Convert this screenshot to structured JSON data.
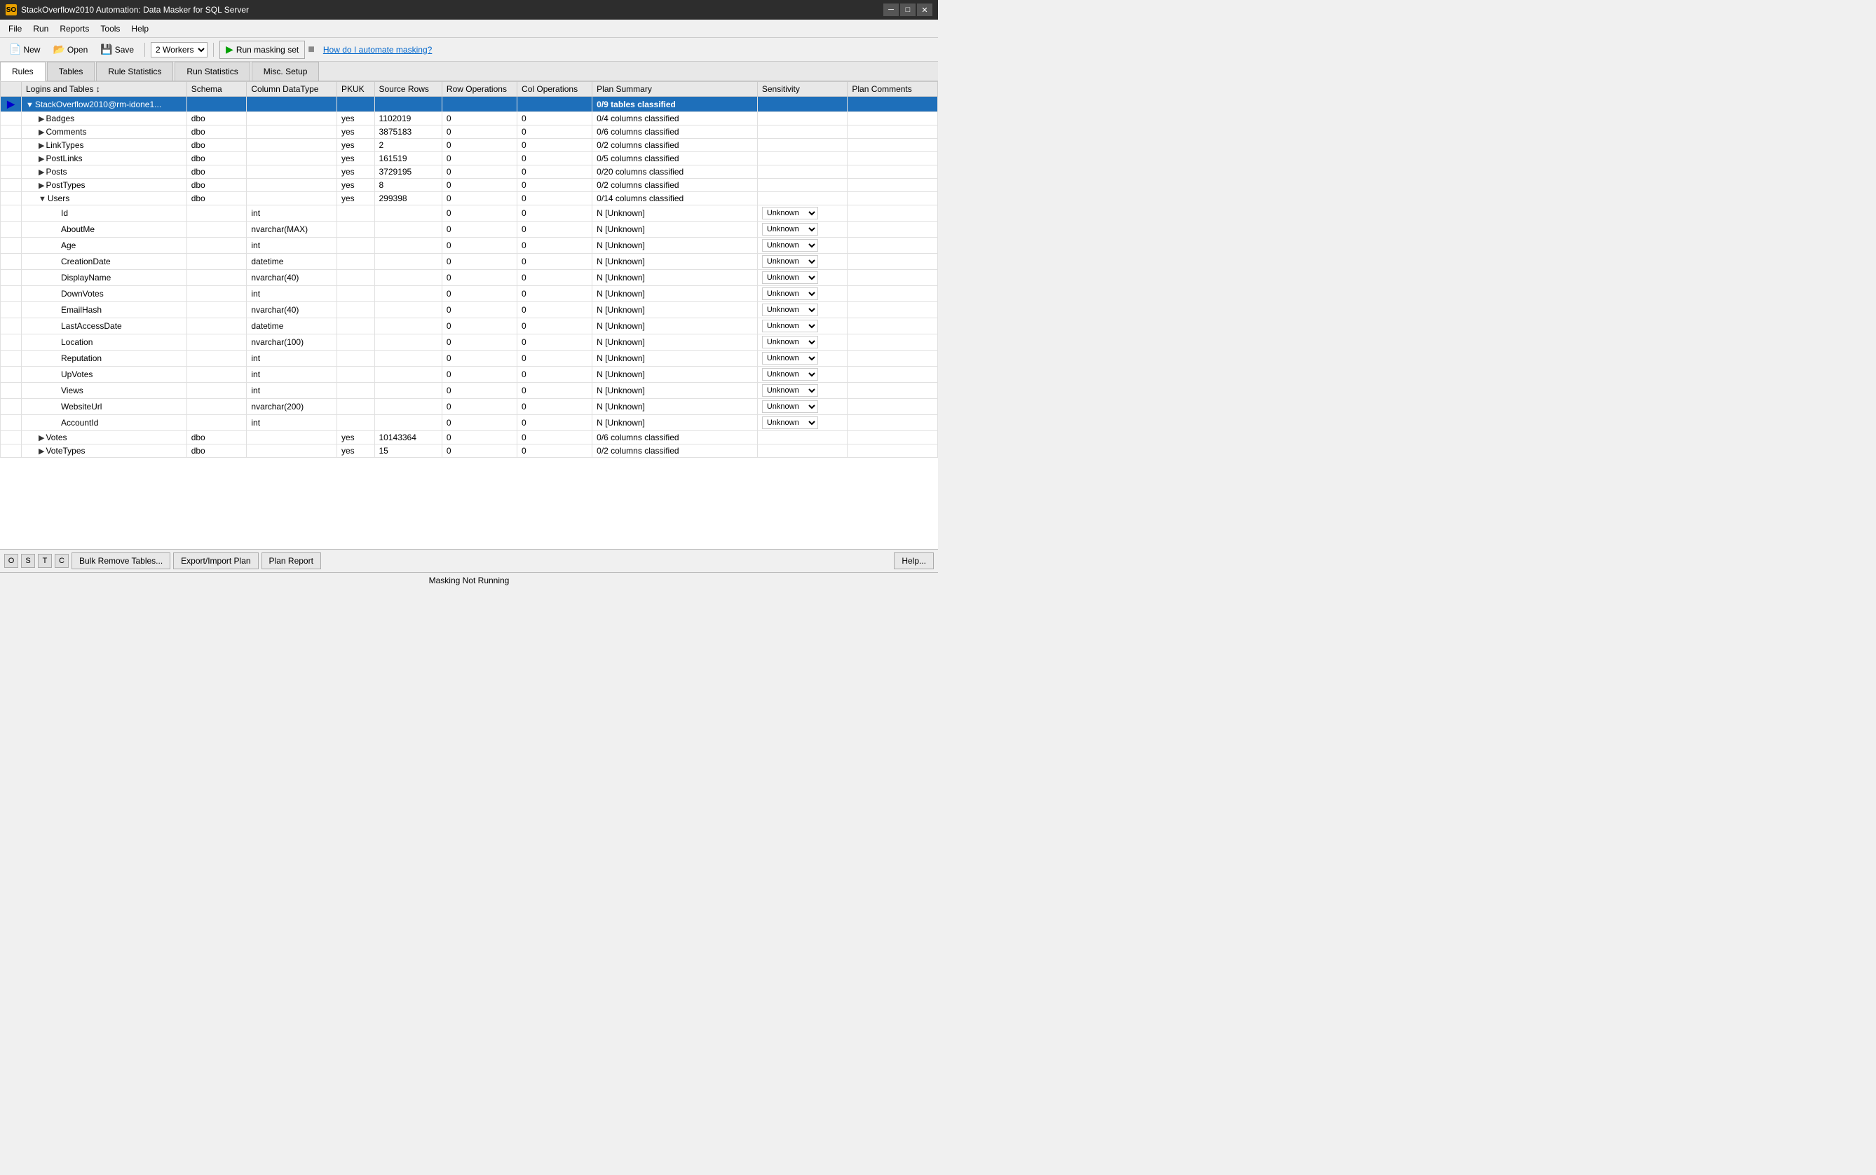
{
  "titleBar": {
    "icon": "SO",
    "title": "StackOverflow2010 Automation: Data Masker for SQL Server",
    "minimizeBtn": "─",
    "maximizeBtn": "□",
    "closeBtn": "✕"
  },
  "menuBar": {
    "items": [
      "File",
      "Run",
      "Reports",
      "Tools",
      "Help"
    ]
  },
  "toolbar": {
    "newLabel": "New",
    "openLabel": "Open",
    "saveLabel": "Save",
    "workersLabel": "2 Workers",
    "runLabel": "Run masking set",
    "helpLink": "How do I automate masking?"
  },
  "tabs": [
    {
      "id": "rules",
      "label": "Rules",
      "active": true
    },
    {
      "id": "tables",
      "label": "Tables",
      "active": false
    },
    {
      "id": "rule-statistics",
      "label": "Rule Statistics",
      "active": false
    },
    {
      "id": "run-statistics",
      "label": "Run Statistics",
      "active": false
    },
    {
      "id": "misc-setup",
      "label": "Misc. Setup",
      "active": false
    }
  ],
  "tableHeaders": [
    {
      "key": "logins",
      "label": "Logins and Tables"
    },
    {
      "key": "schema",
      "label": "Schema"
    },
    {
      "key": "datatype",
      "label": "Column DataType"
    },
    {
      "key": "pkuk",
      "label": "PKUK"
    },
    {
      "key": "sourceRows",
      "label": "Source Rows"
    },
    {
      "key": "rowOps",
      "label": "Row Operations"
    },
    {
      "key": "colOps",
      "label": "Col Operations"
    },
    {
      "key": "planSummary",
      "label": "Plan Summary"
    },
    {
      "key": "sensitivity",
      "label": "Sensitivity"
    },
    {
      "key": "planComments",
      "label": "Plan Comments"
    }
  ],
  "tableRows": [
    {
      "id": "db-root",
      "level": 1,
      "expandable": true,
      "expanded": true,
      "selected": true,
      "currentRow": true,
      "name": "StackOverflow2010@rm-idone1...",
      "schema": "",
      "datatype": "",
      "pkuk": "",
      "sourceRows": "",
      "rowOps": "",
      "colOps": "",
      "planSummary": "0/9 tables classified",
      "sensitivity": "",
      "planComments": ""
    },
    {
      "id": "badges",
      "level": 2,
      "expandable": true,
      "expanded": false,
      "selected": false,
      "name": "Badges",
      "schema": "dbo",
      "datatype": "",
      "pkuk": "yes",
      "sourceRows": "1102019",
      "rowOps": "0",
      "colOps": "0",
      "planSummary": "0/4 columns classified",
      "sensitivity": "",
      "planComments": ""
    },
    {
      "id": "comments",
      "level": 2,
      "expandable": true,
      "expanded": false,
      "selected": false,
      "name": "Comments",
      "schema": "dbo",
      "datatype": "",
      "pkuk": "yes",
      "sourceRows": "3875183",
      "rowOps": "0",
      "colOps": "0",
      "planSummary": "0/6 columns classified",
      "sensitivity": "",
      "planComments": ""
    },
    {
      "id": "linktypes",
      "level": 2,
      "expandable": true,
      "expanded": false,
      "selected": false,
      "name": "LinkTypes",
      "schema": "dbo",
      "datatype": "",
      "pkuk": "yes",
      "sourceRows": "2",
      "rowOps": "0",
      "colOps": "0",
      "planSummary": "0/2 columns classified",
      "sensitivity": "",
      "planComments": ""
    },
    {
      "id": "postlinks",
      "level": 2,
      "expandable": true,
      "expanded": false,
      "selected": false,
      "name": "PostLinks",
      "schema": "dbo",
      "datatype": "",
      "pkuk": "yes",
      "sourceRows": "161519",
      "rowOps": "0",
      "colOps": "0",
      "planSummary": "0/5 columns classified",
      "sensitivity": "",
      "planComments": ""
    },
    {
      "id": "posts",
      "level": 2,
      "expandable": true,
      "expanded": false,
      "selected": false,
      "name": "Posts",
      "schema": "dbo",
      "datatype": "",
      "pkuk": "yes",
      "sourceRows": "3729195",
      "rowOps": "0",
      "colOps": "0",
      "planSummary": "0/20 columns classified",
      "sensitivity": "",
      "planComments": ""
    },
    {
      "id": "posttypes",
      "level": 2,
      "expandable": true,
      "expanded": false,
      "selected": false,
      "name": "PostTypes",
      "schema": "dbo",
      "datatype": "",
      "pkuk": "yes",
      "sourceRows": "8",
      "rowOps": "0",
      "colOps": "0",
      "planSummary": "0/2 columns classified",
      "sensitivity": "",
      "planComments": ""
    },
    {
      "id": "users",
      "level": 2,
      "expandable": true,
      "expanded": true,
      "selected": false,
      "name": "Users",
      "schema": "dbo",
      "datatype": "",
      "pkuk": "yes",
      "sourceRows": "299398",
      "rowOps": "0",
      "colOps": "0",
      "planSummary": "0/14 columns classified",
      "sensitivity": "",
      "planComments": ""
    },
    {
      "id": "users-id",
      "level": 3,
      "expandable": false,
      "selected": false,
      "name": "Id",
      "schema": "",
      "datatype": "int",
      "pkuk": "",
      "sourceRows": "",
      "rowOps": "0",
      "colOps": "0",
      "planSummary": "N [Unknown]",
      "sensitivity": "Unknown",
      "planComments": ""
    },
    {
      "id": "users-aboutme",
      "level": 3,
      "expandable": false,
      "selected": false,
      "name": "AboutMe",
      "schema": "",
      "datatype": "nvarchar(MAX)",
      "pkuk": "",
      "sourceRows": "",
      "rowOps": "0",
      "colOps": "0",
      "planSummary": "N [Unknown]",
      "sensitivity": "Unknown",
      "planComments": ""
    },
    {
      "id": "users-age",
      "level": 3,
      "expandable": false,
      "selected": false,
      "name": "Age",
      "schema": "",
      "datatype": "int",
      "pkuk": "",
      "sourceRows": "",
      "rowOps": "0",
      "colOps": "0",
      "planSummary": "N [Unknown]",
      "sensitivity": "Unknown",
      "planComments": ""
    },
    {
      "id": "users-creationdate",
      "level": 3,
      "expandable": false,
      "selected": false,
      "name": "CreationDate",
      "schema": "",
      "datatype": "datetime",
      "pkuk": "",
      "sourceRows": "",
      "rowOps": "0",
      "colOps": "0",
      "planSummary": "N [Unknown]",
      "sensitivity": "Unknown",
      "planComments": ""
    },
    {
      "id": "users-displayname",
      "level": 3,
      "expandable": false,
      "selected": false,
      "name": "DisplayName",
      "schema": "",
      "datatype": "nvarchar(40)",
      "pkuk": "",
      "sourceRows": "",
      "rowOps": "0",
      "colOps": "0",
      "planSummary": "N [Unknown]",
      "sensitivity": "Unknown",
      "planComments": ""
    },
    {
      "id": "users-downvotes",
      "level": 3,
      "expandable": false,
      "selected": false,
      "name": "DownVotes",
      "schema": "",
      "datatype": "int",
      "pkuk": "",
      "sourceRows": "",
      "rowOps": "0",
      "colOps": "0",
      "planSummary": "N [Unknown]",
      "sensitivity": "Unknown",
      "planComments": ""
    },
    {
      "id": "users-emailhash",
      "level": 3,
      "expandable": false,
      "selected": false,
      "name": "EmailHash",
      "schema": "",
      "datatype": "nvarchar(40)",
      "pkuk": "",
      "sourceRows": "",
      "rowOps": "0",
      "colOps": "0",
      "planSummary": "N [Unknown]",
      "sensitivity": "Unknown",
      "planComments": ""
    },
    {
      "id": "users-lastaccessdate",
      "level": 3,
      "expandable": false,
      "selected": false,
      "name": "LastAccessDate",
      "schema": "",
      "datatype": "datetime",
      "pkuk": "",
      "sourceRows": "",
      "rowOps": "0",
      "colOps": "0",
      "planSummary": "N [Unknown]",
      "sensitivity": "Unknown",
      "planComments": ""
    },
    {
      "id": "users-location",
      "level": 3,
      "expandable": false,
      "selected": false,
      "name": "Location",
      "schema": "",
      "datatype": "nvarchar(100)",
      "pkuk": "",
      "sourceRows": "",
      "rowOps": "0",
      "colOps": "0",
      "planSummary": "N [Unknown]",
      "sensitivity": "Unknown",
      "planComments": ""
    },
    {
      "id": "users-reputation",
      "level": 3,
      "expandable": false,
      "selected": false,
      "name": "Reputation",
      "schema": "",
      "datatype": "int",
      "pkuk": "",
      "sourceRows": "",
      "rowOps": "0",
      "colOps": "0",
      "planSummary": "N [Unknown]",
      "sensitivity": "Unknown",
      "planComments": ""
    },
    {
      "id": "users-upvotes",
      "level": 3,
      "expandable": false,
      "selected": false,
      "name": "UpVotes",
      "schema": "",
      "datatype": "int",
      "pkuk": "",
      "sourceRows": "",
      "rowOps": "0",
      "colOps": "0",
      "planSummary": "N [Unknown]",
      "sensitivity": "Unknown",
      "planComments": ""
    },
    {
      "id": "users-views",
      "level": 3,
      "expandable": false,
      "selected": false,
      "name": "Views",
      "schema": "",
      "datatype": "int",
      "pkuk": "",
      "sourceRows": "",
      "rowOps": "0",
      "colOps": "0",
      "planSummary": "N [Unknown]",
      "sensitivity": "Unknown",
      "planComments": ""
    },
    {
      "id": "users-websiteurl",
      "level": 3,
      "expandable": false,
      "selected": false,
      "name": "WebsiteUrl",
      "schema": "",
      "datatype": "nvarchar(200)",
      "pkuk": "",
      "sourceRows": "",
      "rowOps": "0",
      "colOps": "0",
      "planSummary": "N [Unknown]",
      "sensitivity": "Unknown",
      "planComments": ""
    },
    {
      "id": "users-accountid",
      "level": 3,
      "expandable": false,
      "selected": false,
      "name": "AccountId",
      "schema": "",
      "datatype": "int",
      "pkuk": "",
      "sourceRows": "",
      "rowOps": "0",
      "colOps": "0",
      "planSummary": "N [Unknown]",
      "sensitivity": "Unknown",
      "planComments": ""
    },
    {
      "id": "votes",
      "level": 2,
      "expandable": true,
      "expanded": false,
      "selected": false,
      "name": "Votes",
      "schema": "dbo",
      "datatype": "",
      "pkuk": "yes",
      "sourceRows": "10143364",
      "rowOps": "0",
      "colOps": "0",
      "planSummary": "0/6 columns classified",
      "sensitivity": "",
      "planComments": ""
    },
    {
      "id": "votetypes",
      "level": 2,
      "expandable": true,
      "expanded": false,
      "selected": false,
      "name": "VoteTypes",
      "schema": "dbo",
      "datatype": "",
      "pkuk": "yes",
      "sourceRows": "15",
      "rowOps": "0",
      "colOps": "0",
      "planSummary": "0/2 columns classified",
      "sensitivity": "",
      "planComments": ""
    }
  ],
  "bottomBar": {
    "letters": [
      "O",
      "S",
      "T",
      "C"
    ],
    "buttons": [
      "Bulk Remove Tables...",
      "Export/Import Plan",
      "Plan Report"
    ],
    "helpBtn": "Help..."
  },
  "statusBar": {
    "text": "Masking Not Running"
  }
}
